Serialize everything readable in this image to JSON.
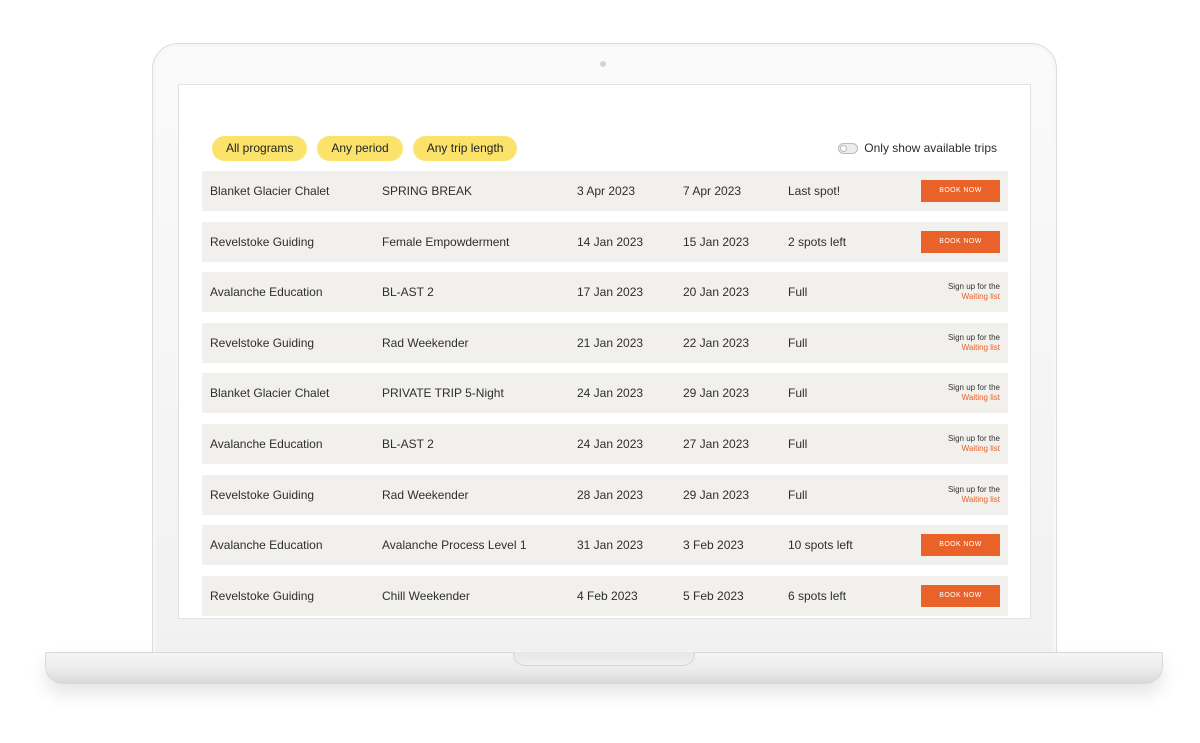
{
  "filters": [
    {
      "label": "All programs"
    },
    {
      "label": "Any period"
    },
    {
      "label": "Any trip length"
    }
  ],
  "availability_toggle": {
    "label": "Only show available trips",
    "on": false
  },
  "colors": {
    "accent": "#e8622a",
    "pill": "#fbe36b",
    "row_bg": "#f1f0ec"
  },
  "rows": [
    {
      "program": "Blanket Glacier Chalet",
      "trip": "SPRING BREAK",
      "start": "3 Apr 2023",
      "end": "7 Apr 2023",
      "availability": "Last spot!",
      "action": "book",
      "book_label": "BOOK NOW"
    },
    {
      "program": "Revelstoke Guiding",
      "trip": "Female Empowderment",
      "start": "14 Jan 2023",
      "end": "15 Jan 2023",
      "availability": "2 spots left",
      "action": "book",
      "book_label": "BOOK NOW"
    },
    {
      "program": "Avalanche Education",
      "trip": "BL-AST 2",
      "start": "17 Jan 2023",
      "end": "20 Jan 2023",
      "availability": "Full",
      "action": "waitlist",
      "waitlist_text": "Sign up for the",
      "waitlist_link": "Waiting list"
    },
    {
      "program": "Revelstoke Guiding",
      "trip": "Rad Weekender",
      "start": "21 Jan 2023",
      "end": "22 Jan 2023",
      "availability": "Full",
      "action": "waitlist",
      "waitlist_text": "Sign up for the",
      "waitlist_link": "Waiting list"
    },
    {
      "program": "Blanket Glacier Chalet",
      "trip": "PRIVATE TRIP 5-Night",
      "start": "24 Jan 2023",
      "end": "29 Jan 2023",
      "availability": "Full",
      "action": "waitlist",
      "waitlist_text": "Sign up for the",
      "waitlist_link": "Waiting list"
    },
    {
      "program": "Avalanche Education",
      "trip": "BL-AST 2",
      "start": "24 Jan 2023",
      "end": "27 Jan 2023",
      "availability": "Full",
      "action": "waitlist",
      "waitlist_text": "Sign up for the",
      "waitlist_link": "Waiting list"
    },
    {
      "program": "Revelstoke Guiding",
      "trip": "Rad Weekender",
      "start": "28 Jan 2023",
      "end": "29 Jan 2023",
      "availability": "Full",
      "action": "waitlist",
      "waitlist_text": "Sign up for the",
      "waitlist_link": "Waiting list"
    },
    {
      "program": "Avalanche Education",
      "trip": "Avalanche Process Level 1",
      "start": "31 Jan 2023",
      "end": "3 Feb 2023",
      "availability": "10 spots left",
      "action": "book",
      "book_label": "BOOK NOW"
    },
    {
      "program": "Revelstoke Guiding",
      "trip": "Chill Weekender",
      "start": "4 Feb 2023",
      "end": "5 Feb 2023",
      "availability": "6 spots left",
      "action": "book",
      "book_label": "BOOK NOW"
    }
  ]
}
